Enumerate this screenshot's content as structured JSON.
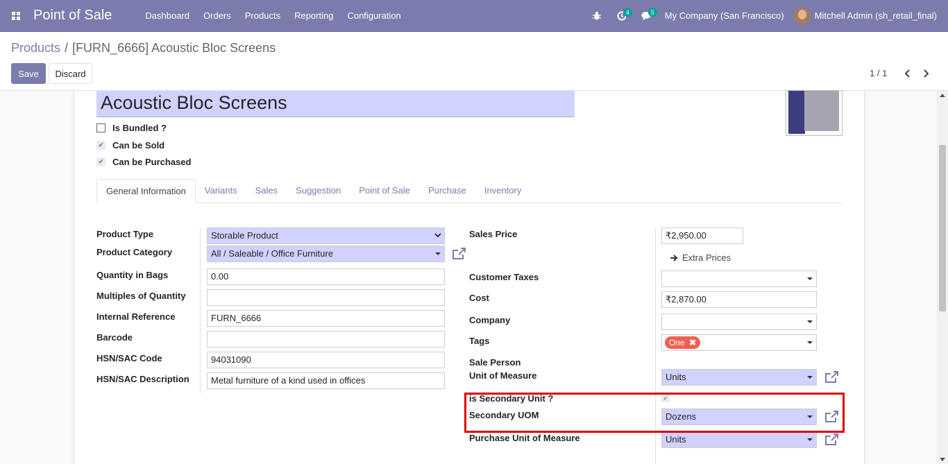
{
  "navbar": {
    "app_title": "Point of Sale",
    "menu": [
      "Dashboard",
      "Orders",
      "Products",
      "Reporting",
      "Configuration"
    ],
    "activity_count": "4",
    "messages_count": "5",
    "company": "My Company (San Francisco)",
    "user": "Mitchell Admin (sh_retail_final)"
  },
  "control_panel": {
    "breadcrumb_parent": "Products",
    "breadcrumb_separator": "/",
    "breadcrumb_current": "[FURN_6666] Acoustic Bloc Screens",
    "save_label": "Save",
    "discard_label": "Discard",
    "pager": "1 / 1"
  },
  "form": {
    "product_name": "Acoustic Bloc Screens",
    "is_bundled_label": "Is Bundled ?",
    "can_be_sold_label": "Can be Sold",
    "can_be_purchased_label": "Can be Purchased",
    "tabs": [
      "General Information",
      "Variants",
      "Sales",
      "Suggestion",
      "Point of Sale",
      "Purchase",
      "Inventory"
    ],
    "left": {
      "product_type_label": "Product Type",
      "product_type": "Storable Product",
      "product_category_label": "Product Category",
      "product_category": "All / Saleable / Office Furniture",
      "quantity_in_bags_label": "Quantity in Bags",
      "quantity_in_bags": "0.00",
      "multiples_label": "Multiples of Quantity",
      "multiples": "",
      "internal_ref_label": "Internal Reference",
      "internal_ref": "FURN_6666",
      "barcode_label": "Barcode",
      "barcode": "",
      "hsn_code_label": "HSN/SAC Code",
      "hsn_code": "94031090",
      "hsn_desc_label": "HSN/SAC Description",
      "hsn_desc": "Metal furniture of a kind used in offices"
    },
    "right": {
      "sales_price_label": "Sales Price",
      "sales_price": "₹2,950.00",
      "extra_prices_label": "Extra Prices",
      "customer_taxes_label": "Customer Taxes",
      "cost_label": "Cost",
      "cost": "₹2,870.00",
      "company_label": "Company",
      "tags_label": "Tags",
      "tag_one": "One",
      "sale_person_label": "Sale Person",
      "uom_label": "Unit of Measure",
      "uom": "Units",
      "is_secondary_label": "is Secondary Unit ?",
      "secondary_uom_label": "Secondary UOM",
      "secondary_uom": "Dozens",
      "purchase_uom_label": "Purchase Unit of Measure",
      "purchase_uom": "Units"
    }
  },
  "colors": {
    "brand": "#7c7bad",
    "required_field": "#d2d2ff",
    "highlight": "#e00000",
    "tag": "#f06050"
  }
}
